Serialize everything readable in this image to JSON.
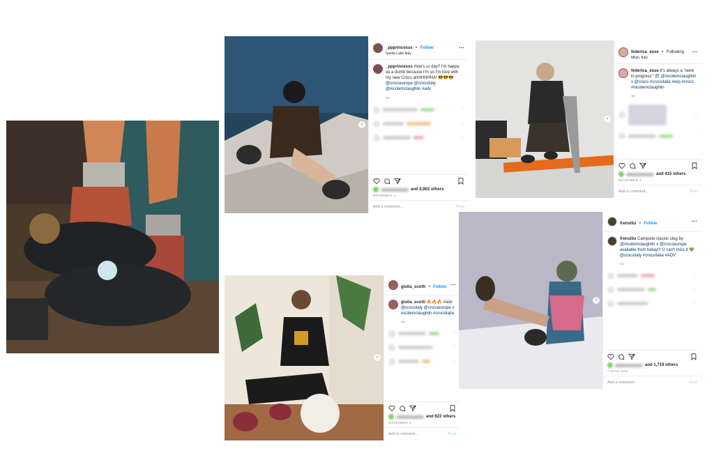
{
  "posts": [
    {
      "username": "_ppprincesss",
      "follow_label": "Follow",
      "location": "Garda Lake Italy",
      "caption_user": "_ppprincesss",
      "caption_text": "How's ur day? I'm happy as a dumb because I'm so I'm love with my new Crocs ahHHHHHA! 😎😎😎",
      "caption_tags": "@crocseurope @crocsitaly @nicolemclaughlin #adv",
      "caption_time": "1w",
      "likes": "and 8,902 others",
      "date": "NOVEMBER 1",
      "add_comment": "Add a comment...",
      "post_label": "Post"
    },
    {
      "username": "federica_esse",
      "follow_label": "Following",
      "location": "Milan, Italy",
      "caption_user": "federica_esse",
      "caption_text": "It's always a \"work in progress\" 🛠",
      "caption_tags": "@nicolemclaughlin x @crocs #crocsitalia #wip #crocs #nicolemclaughlin",
      "caption_time": "1w",
      "likes": "and 415 others",
      "date": "NOVEMBER 4",
      "add_comment": "Add a comment...",
      "post_label": "Post"
    },
    {
      "username": "giulia_scotti",
      "follow_label": "Follow",
      "location": "",
      "caption_user": "giulia_scotti",
      "caption_text": "🔥🔥🔥 #adv",
      "caption_tags": "@crocsitaly @crocseurope x nicolemclaughlin #crocsitalia",
      "caption_time": "1w",
      "likes": "and 622 others",
      "date": "NOVEMBER 8",
      "add_comment": "Add a comment...",
      "post_label": "Post"
    },
    {
      "username": "frensiliu",
      "follow_label": "Follow",
      "location": "",
      "caption_user": "frensiliu",
      "caption_text": "Campsite classic clog by",
      "caption_tags": "@nicolemclaughlin x @crocseurope available from today!!! U can't miss it 💚@crocsitaly #crocsitalia #ADV",
      "caption_time": "1w",
      "likes": "and 1,719 others",
      "date": "7 DAYS AGO",
      "add_comment": "Add a comment...",
      "post_label": "Post"
    }
  ],
  "colors": {
    "link_blue": "#0095f6",
    "tag_blue": "#00376b",
    "muted": "#8e8e8e"
  },
  "icons": [
    "heart-icon",
    "comment-icon",
    "share-icon",
    "bookmark-icon",
    "more-icon"
  ]
}
